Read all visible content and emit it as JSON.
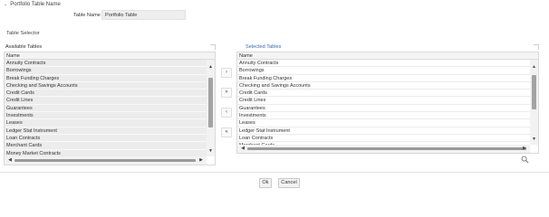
{
  "section": {
    "title": "Portfolio Table Name"
  },
  "table_name": {
    "label": "Table Name",
    "value": "Portfolio Table"
  },
  "table_selector": {
    "title": "Table Selector"
  },
  "available": {
    "title": "Available Tables",
    "column": "Name",
    "rows": [
      "Annuity Contracts",
      "Borrowings",
      "Break Funding Charges",
      "Checking and Savings Accounts",
      "Credit Cards",
      "Credit Lines",
      "Guarantees",
      "Investments",
      "Leases",
      "Ledger Stat Instrument",
      "Loan Contracts",
      "Merchant Cards",
      "Money Market Contracts"
    ]
  },
  "selected": {
    "title": "Selected Tables",
    "column": "Name",
    "rows": [
      "Annuity Contracts",
      "Borrowings",
      "Break Funding Charges",
      "Checking and Savings Accounts",
      "Credit Cards",
      "Credit Lines",
      "Guarantees",
      "Investments",
      "Leases",
      "Ledger Stat Instrument",
      "Loan Contracts",
      "Merchant Cards"
    ]
  },
  "move_buttons": [
    {
      "name": "move-right-button",
      "glyph": "›"
    },
    {
      "name": "move-all-right-button",
      "glyph": "»"
    },
    {
      "name": "move-left-button",
      "glyph": "‹"
    },
    {
      "name": "move-all-left-button",
      "glyph": "«"
    }
  ],
  "icons": {
    "collapse": "chevron-down-icon",
    "search": "search-icon"
  },
  "footer": {
    "ok_label": "Ok",
    "cancel_label": "Cancel"
  },
  "colors": {
    "accent": "#2a6ebb",
    "grid_row": "#ececec",
    "scroll_thumb": "#a3a3a3"
  }
}
